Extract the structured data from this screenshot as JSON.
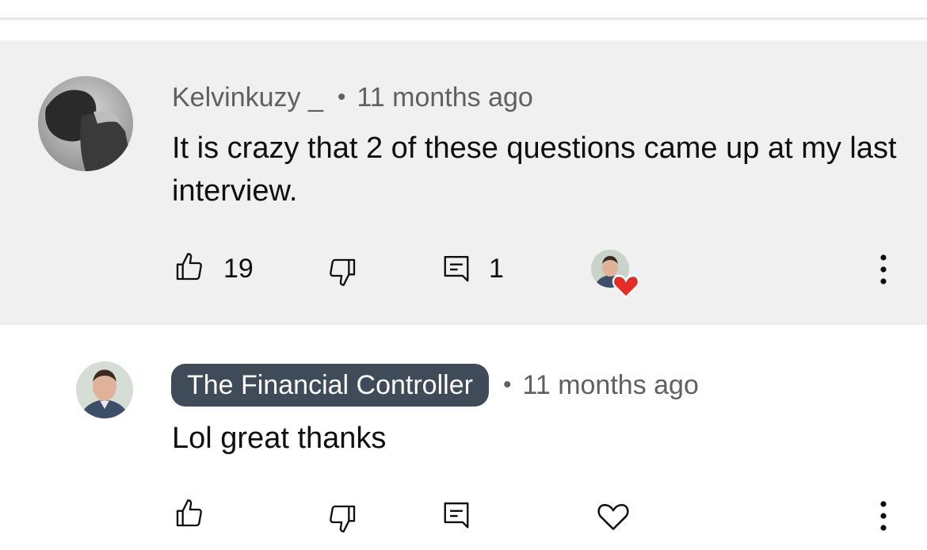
{
  "comments": [
    {
      "author": "Kelvinkuzy _",
      "separator": "•",
      "timestamp": "11 months ago",
      "text": "It is crazy that 2 of these questions came up at my last interview.",
      "likes": "19",
      "replies": "1",
      "avatar_icon": "user-photo-avatar",
      "creator_heart": true
    },
    {
      "author": "The Financial Controller",
      "author_is_channel_owner": true,
      "separator": "•",
      "timestamp": "11 months ago",
      "text": "Lol great thanks",
      "avatar_icon": "channel-owner-photo-avatar"
    }
  ],
  "icons": {
    "like": "thumbs-up-icon",
    "dislike": "thumbs-down-icon",
    "reply": "reply-icon",
    "heart": "heart-icon",
    "more": "more-vertical-icon"
  },
  "colors": {
    "highlight_bg": "#f0f0f0",
    "channel_chip_bg": "#3f4b59",
    "heart_red": "#e52d27",
    "meta_text": "#606060"
  }
}
